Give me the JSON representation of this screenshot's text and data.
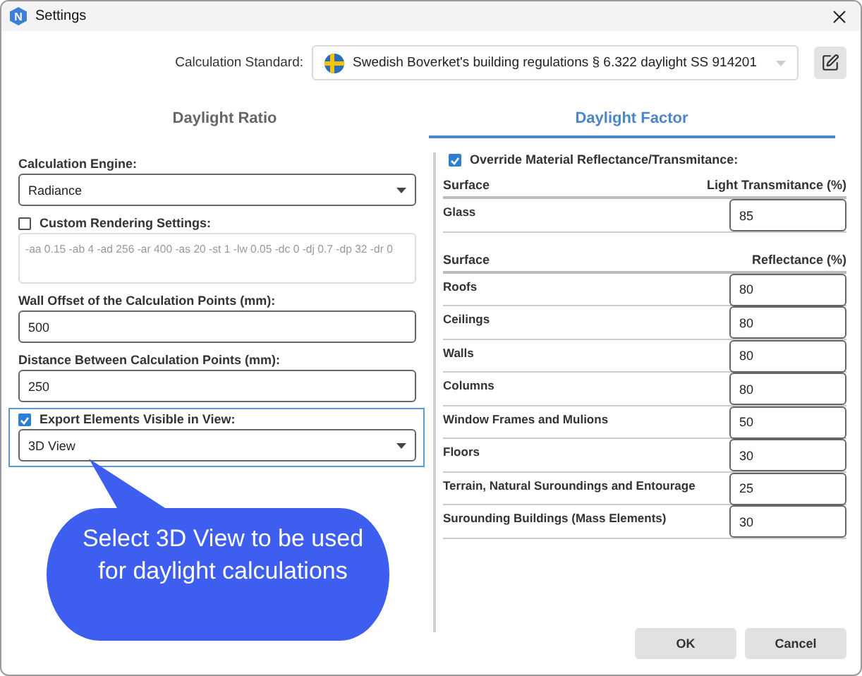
{
  "window": {
    "title": "Settings",
    "logo_letter": "N"
  },
  "calculation_standard": {
    "label": "Calculation Standard:",
    "value": "Swedish Boverket's building regulations § 6.322 daylight SS 914201"
  },
  "tabs": [
    {
      "label": "Daylight Ratio",
      "selected": false
    },
    {
      "label": "Daylight Factor",
      "selected": true
    }
  ],
  "left_fields": [
    {
      "kind": "select",
      "label": "Calculation Engine:",
      "value": "Radiance"
    },
    {
      "kind": "check_text",
      "label": "Custom Rendering Settings:",
      "checked": false,
      "disabled": true,
      "value": "-aa 0.15 -ab 4 -ad 256 -ar 400 -as 20 -st 1 -lw 0.05 -dc 0 -dj 0.7 -dp 32 -dr 0"
    },
    {
      "kind": "input",
      "label": "Wall Offset of the Calculation Points (mm):",
      "value": "500"
    },
    {
      "kind": "input",
      "label": "Distance Between Calculation Points (mm):",
      "value": "250"
    },
    {
      "kind": "check_select",
      "label": "Export Elements Visible in View:",
      "checked": true,
      "focused": true,
      "value": "3D View"
    }
  ],
  "override": {
    "label": "Override Material Reflectance/Transmitance:",
    "checked": true
  },
  "tables": [
    {
      "columns": [
        "Surface",
        "Light Transmitance (%)"
      ],
      "rows": [
        {
          "surface": "Glass",
          "value": "85"
        }
      ]
    },
    {
      "columns": [
        "Surface",
        "Reflectance (%)"
      ],
      "rows": [
        {
          "surface": "Roofs",
          "value": "80"
        },
        {
          "surface": "Ceilings",
          "value": "80"
        },
        {
          "surface": "Walls",
          "value": "80"
        },
        {
          "surface": "Columns",
          "value": "80"
        },
        {
          "surface": "Window Frames and Mulions",
          "value": "50"
        },
        {
          "surface": "Floors",
          "value": "30"
        },
        {
          "surface": "Terrain, Natural Suroundings and Entourage",
          "value": "25"
        },
        {
          "surface": "Surounding Buildings (Mass Elements)",
          "value": "30"
        }
      ]
    }
  ],
  "buttons": [
    "OK",
    "Cancel"
  ],
  "callout": {
    "text": "Select 3D View to be used for daylight calculations"
  }
}
